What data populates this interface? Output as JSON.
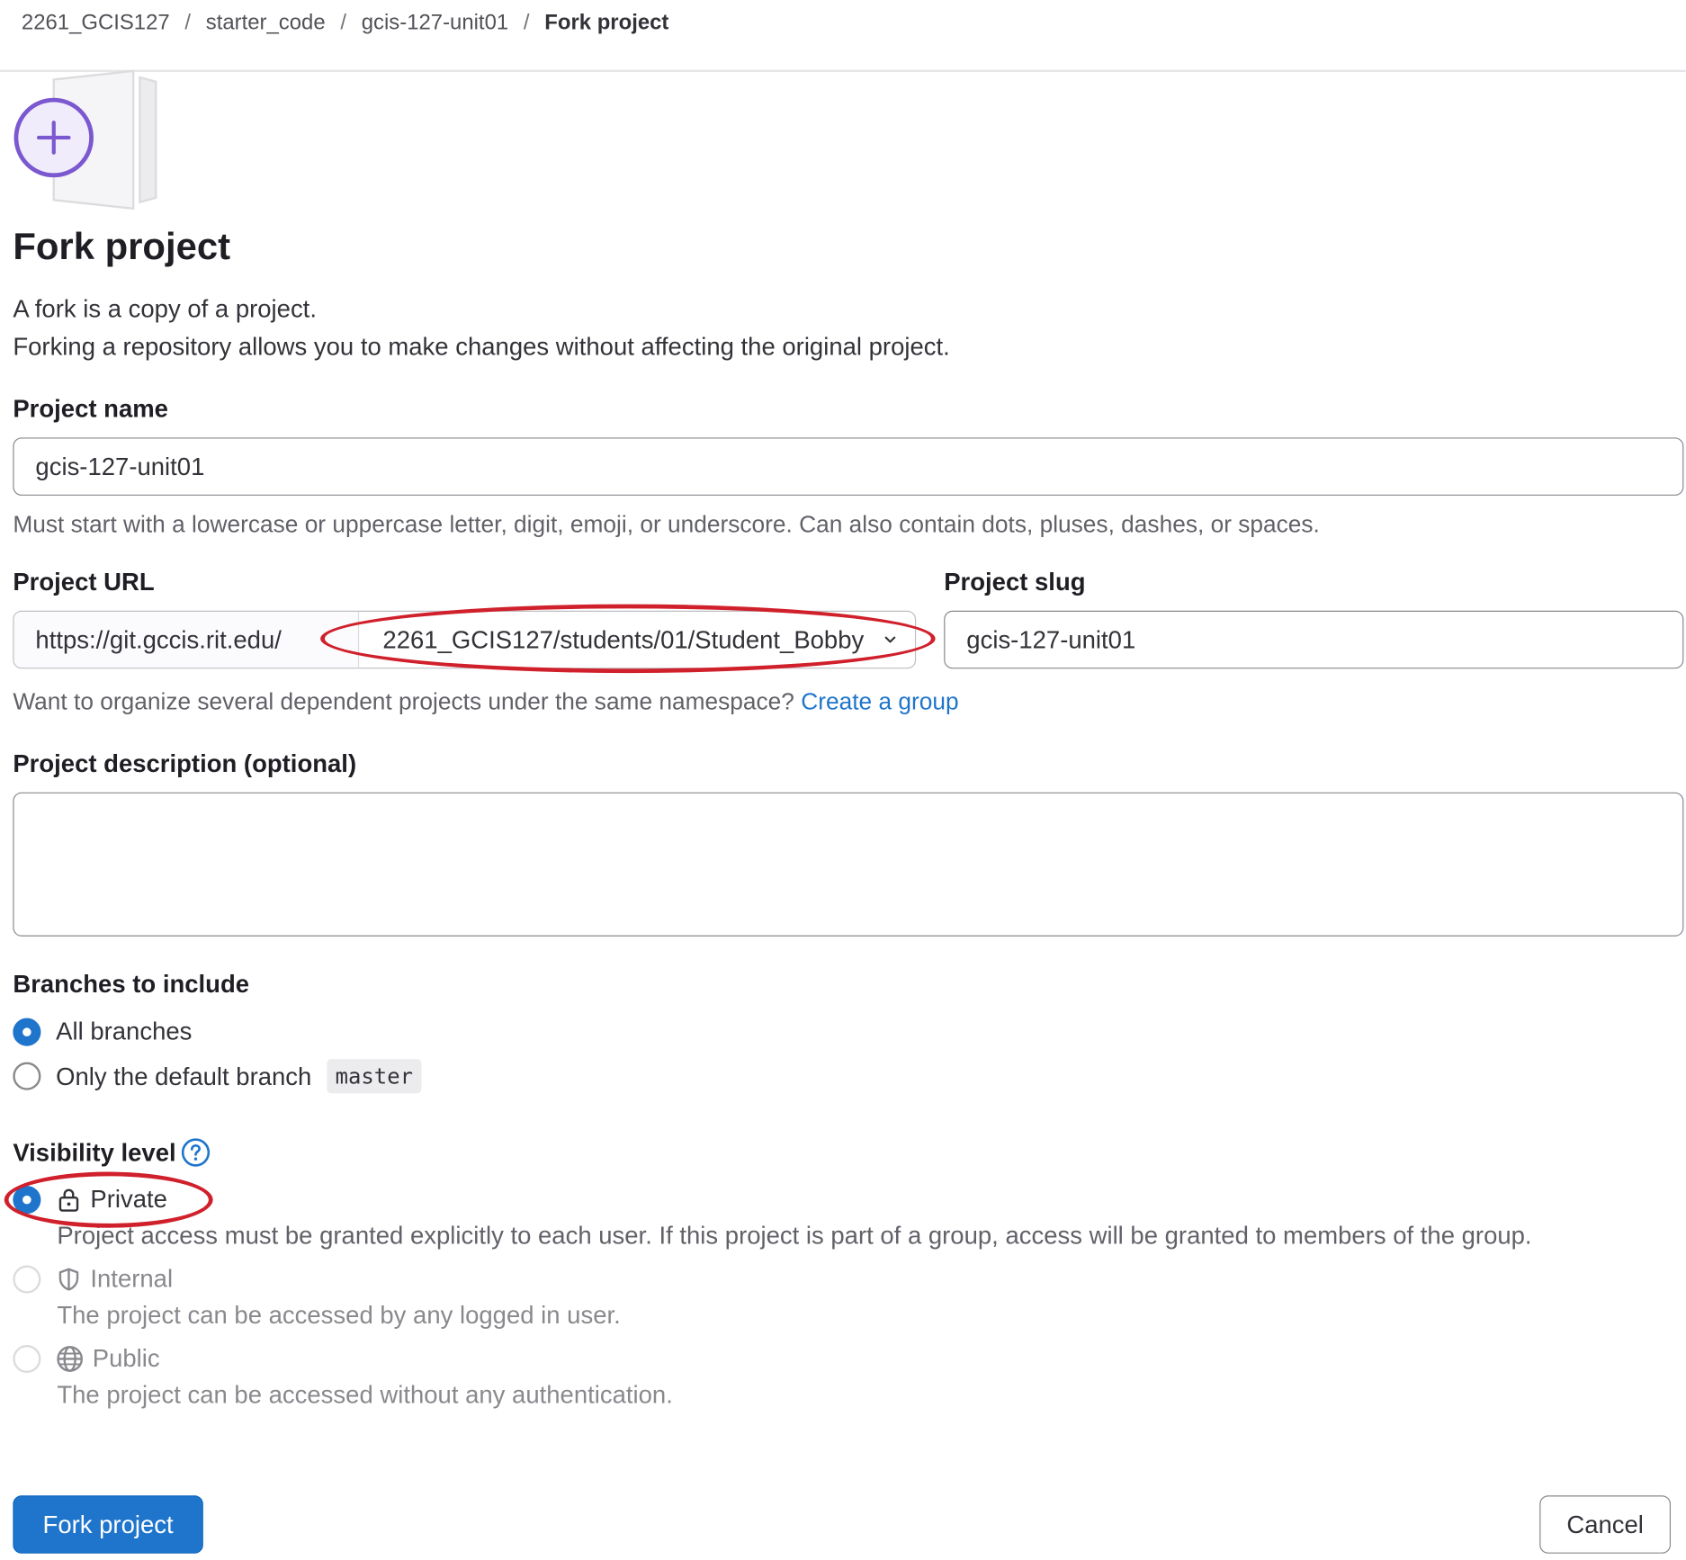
{
  "breadcrumb": {
    "items": [
      "2261_GCIS127",
      "starter_code",
      "gcis-127-unit01"
    ],
    "current": "Fork project",
    "separator": "/"
  },
  "header": {
    "title": "Fork project",
    "desc_line1": "A fork is a copy of a project.",
    "desc_line2": "Forking a repository allows you to make changes without affecting the original project."
  },
  "project_name": {
    "label": "Project name",
    "value": "gcis-127-unit01",
    "help": "Must start with a lowercase or uppercase letter, digit, emoji, or underscore. Can also contain dots, pluses, dashes, or spaces."
  },
  "project_url": {
    "label": "Project URL",
    "prefix": "https://git.gccis.rit.edu/",
    "namespace": "2261_GCIS127/students/01/Student_Bobby"
  },
  "project_slug": {
    "label": "Project slug",
    "value": "gcis-127-unit01"
  },
  "namespace_help": {
    "text": "Want to organize several dependent projects under the same namespace?",
    "link": "Create a group"
  },
  "description": {
    "label": "Project description (optional)",
    "value": ""
  },
  "branches": {
    "label": "Branches to include",
    "all": "All branches",
    "default_only": "Only the default branch",
    "default_branch": "master",
    "selected": "all"
  },
  "visibility": {
    "label": "Visibility level",
    "private_label": "Private",
    "private_desc": "Project access must be granted explicitly to each user. If this project is part of a group, access will be granted to members of the group.",
    "internal_label": "Internal",
    "internal_desc": "The project can be accessed by any logged in user.",
    "public_label": "Public",
    "public_desc": "The project can be accessed without any authentication.",
    "selected": "private"
  },
  "actions": {
    "fork_label": "Fork project",
    "cancel_label": "Cancel"
  },
  "colors": {
    "accent": "#1f75cb",
    "annotation": "#d0202b",
    "illustration_purple": "#7b58cf"
  },
  "icons": [
    "plus-icon",
    "chevron-down-icon",
    "help-circle-icon",
    "lock-icon",
    "shield-icon",
    "globe-icon"
  ]
}
